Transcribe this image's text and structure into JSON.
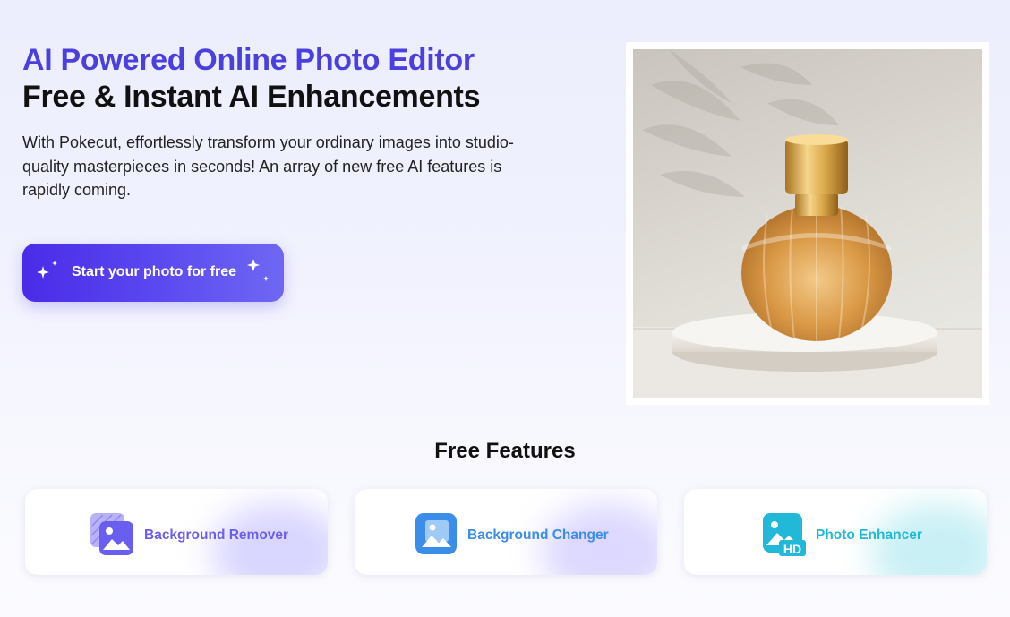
{
  "hero": {
    "title_line1": "AI Powered Online Photo Editor",
    "title_line2": "Free & Instant AI Enhancements",
    "description": "With Pokecut, effortlessly transform your ordinary images into studio-quality masterpieces in seconds! An array of new free AI features is rapidly coming.",
    "cta_label": "Start your photo for free",
    "cta_icon": "sparkle-icon"
  },
  "preview_image": {
    "subject": "perfume bottle on white pedestal"
  },
  "features": {
    "title": "Free Features",
    "items": [
      {
        "label": "Background Remover",
        "icon": "background-remover-icon",
        "color": "#6a5ef0"
      },
      {
        "label": "Background Changer",
        "icon": "background-changer-icon",
        "color": "#3a8de8"
      },
      {
        "label": "Photo Enhancer",
        "icon": "photo-enhancer-icon",
        "color": "#22b8d8"
      }
    ]
  },
  "colors": {
    "brand_purple": "#4b3fe0",
    "cta_start": "#4a2be8",
    "cta_end": "#6f67f3"
  }
}
